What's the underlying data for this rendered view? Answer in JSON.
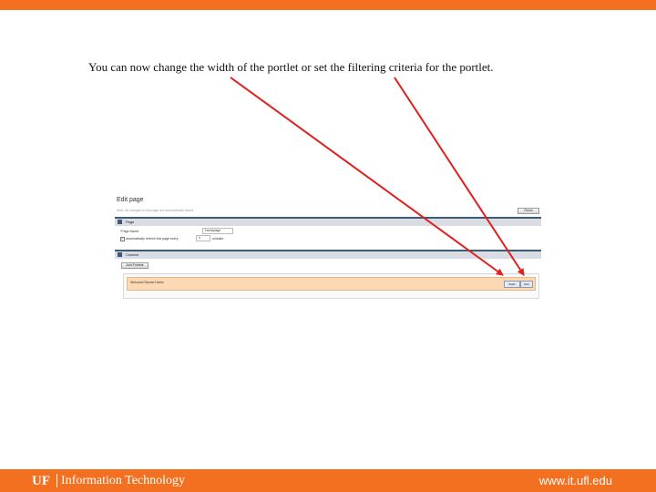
{
  "slide": {
    "caption": "You can now change the width of the portlet or set the filtering criteria for the portlet."
  },
  "screenshot": {
    "title": "Edit page",
    "subtitle": "Note: All changes to this page are automatically saved.",
    "finish_button": "Finish",
    "page_section": {
      "label": "Page",
      "page_name_label": "*Page Name:",
      "page_name_value": "Homepage",
      "refresh_label": "Automatically refresh this page every",
      "refresh_value": "0",
      "refresh_unit": "minutes",
      "refresh_checked": true
    },
    "content_section": {
      "label": "Content",
      "add_button": "Add Portlets",
      "portlet_name": "Welcome Rachel Harris",
      "width_label": "Width",
      "edit_label": "Edit"
    }
  },
  "footer": {
    "logo": "UF",
    "department": "Information Technology",
    "url": "www.it.ufl.edu"
  },
  "colors": {
    "brand_orange": "#f37021",
    "arrow_red": "#e02020",
    "portlet_highlight": "#fcd9b4",
    "section_blue": "#3d5b78"
  }
}
